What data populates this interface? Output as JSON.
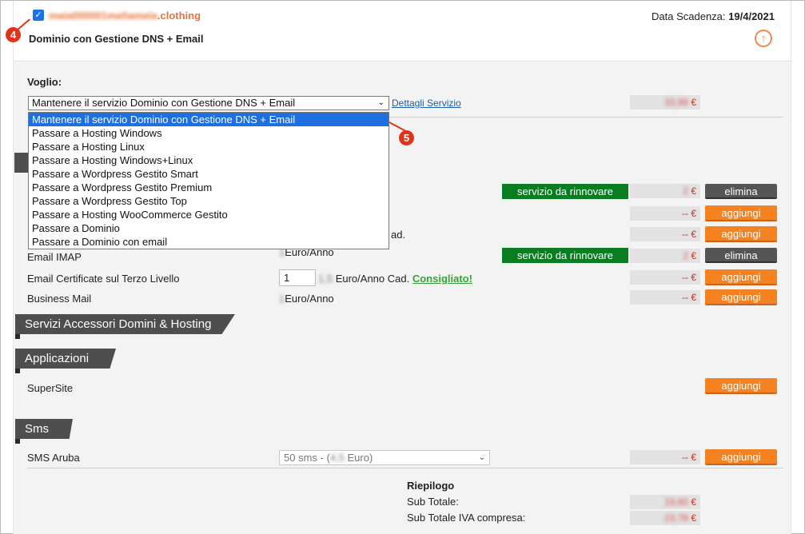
{
  "header": {
    "domain": "maia000001meliameia.clothing",
    "domain_visible_suffix": ".clothing",
    "domain_blurred_part": "maia000001meliameia",
    "service_title": "Dominio con Gestione DNS + Email",
    "expiry_label": "Data Scadenza:",
    "expiry_value": "19/4/2021"
  },
  "markers": {
    "m4": "4",
    "m5": "5"
  },
  "voglio": {
    "label": "Voglio:",
    "selected": "Mantenere il servizio Dominio con Gestione DNS + Email",
    "dettagli_link": "Dettagli Servizio",
    "price": "33,99",
    "currency": "€",
    "options": [
      "Mantenere il servizio Dominio con Gestione DNS + Email",
      "Passare a Hosting Windows",
      "Passare a Hosting Linux",
      "Passare a Hosting Windows+Linux",
      "Passare a Wordpress Gestito Smart",
      "Passare a Wordpress Gestito Premium",
      "Passare a Wordpress Gestito Top",
      "Passare a Hosting WooCommerce Gestito",
      "Passare a Dominio",
      "Passare a Dominio con email"
    ]
  },
  "rows": [
    {
      "status": "servizio da rinnovare",
      "price": "2",
      "currency": "€",
      "action": "elimina"
    },
    {
      "price": "--",
      "currency": "€",
      "action": "aggiungi"
    },
    {
      "tail_text": "ad.",
      "price": "--",
      "currency": "€",
      "action": "aggiungi"
    },
    {
      "label": "Email IMAP",
      "blur_value": "1",
      "unit": "Euro/Anno",
      "status": "servizio da rinnovare",
      "price": "2",
      "currency": "€",
      "action": "elimina"
    },
    {
      "label": "Email Certificate sul Terzo Livello",
      "qty": "1",
      "blur_value": "1,5",
      "unit": "Euro/Anno Cad.",
      "recommended": "Consigliato!",
      "price": "--",
      "currency": "€",
      "action": "aggiungi"
    },
    {
      "label": "Business Mail",
      "blur_value": "1",
      "unit": "Euro/Anno",
      "price": "--",
      "currency": "€",
      "action": "aggiungi"
    }
  ],
  "sections": {
    "accessori": "Servizi Accessori Domini & Hosting",
    "applicazioni": "Applicazioni",
    "sms": "Sms"
  },
  "supersite": {
    "label": "SuperSite",
    "action": "aggiungi"
  },
  "sms_row": {
    "label": "SMS Aruba",
    "select_prefix": "50 sms - (",
    "select_blur": "4,5",
    "select_suffix": " Euro)",
    "price": "--",
    "currency": "€",
    "action": "aggiungi"
  },
  "riepilogo": {
    "title": "Riepilogo",
    "subtotal_label": "Sub Totale:",
    "subtotal_value": "19,60",
    "subtotal_iva_label": "Sub Totale IVA compresa:",
    "subtotal_iva_value": "23,78",
    "currency": "€"
  },
  "colors": {
    "accent_orange": "#f58220",
    "status_green": "#0a7d22",
    "dropdown_highlight": "#1e6fe0",
    "marker_red": "#e23318"
  }
}
